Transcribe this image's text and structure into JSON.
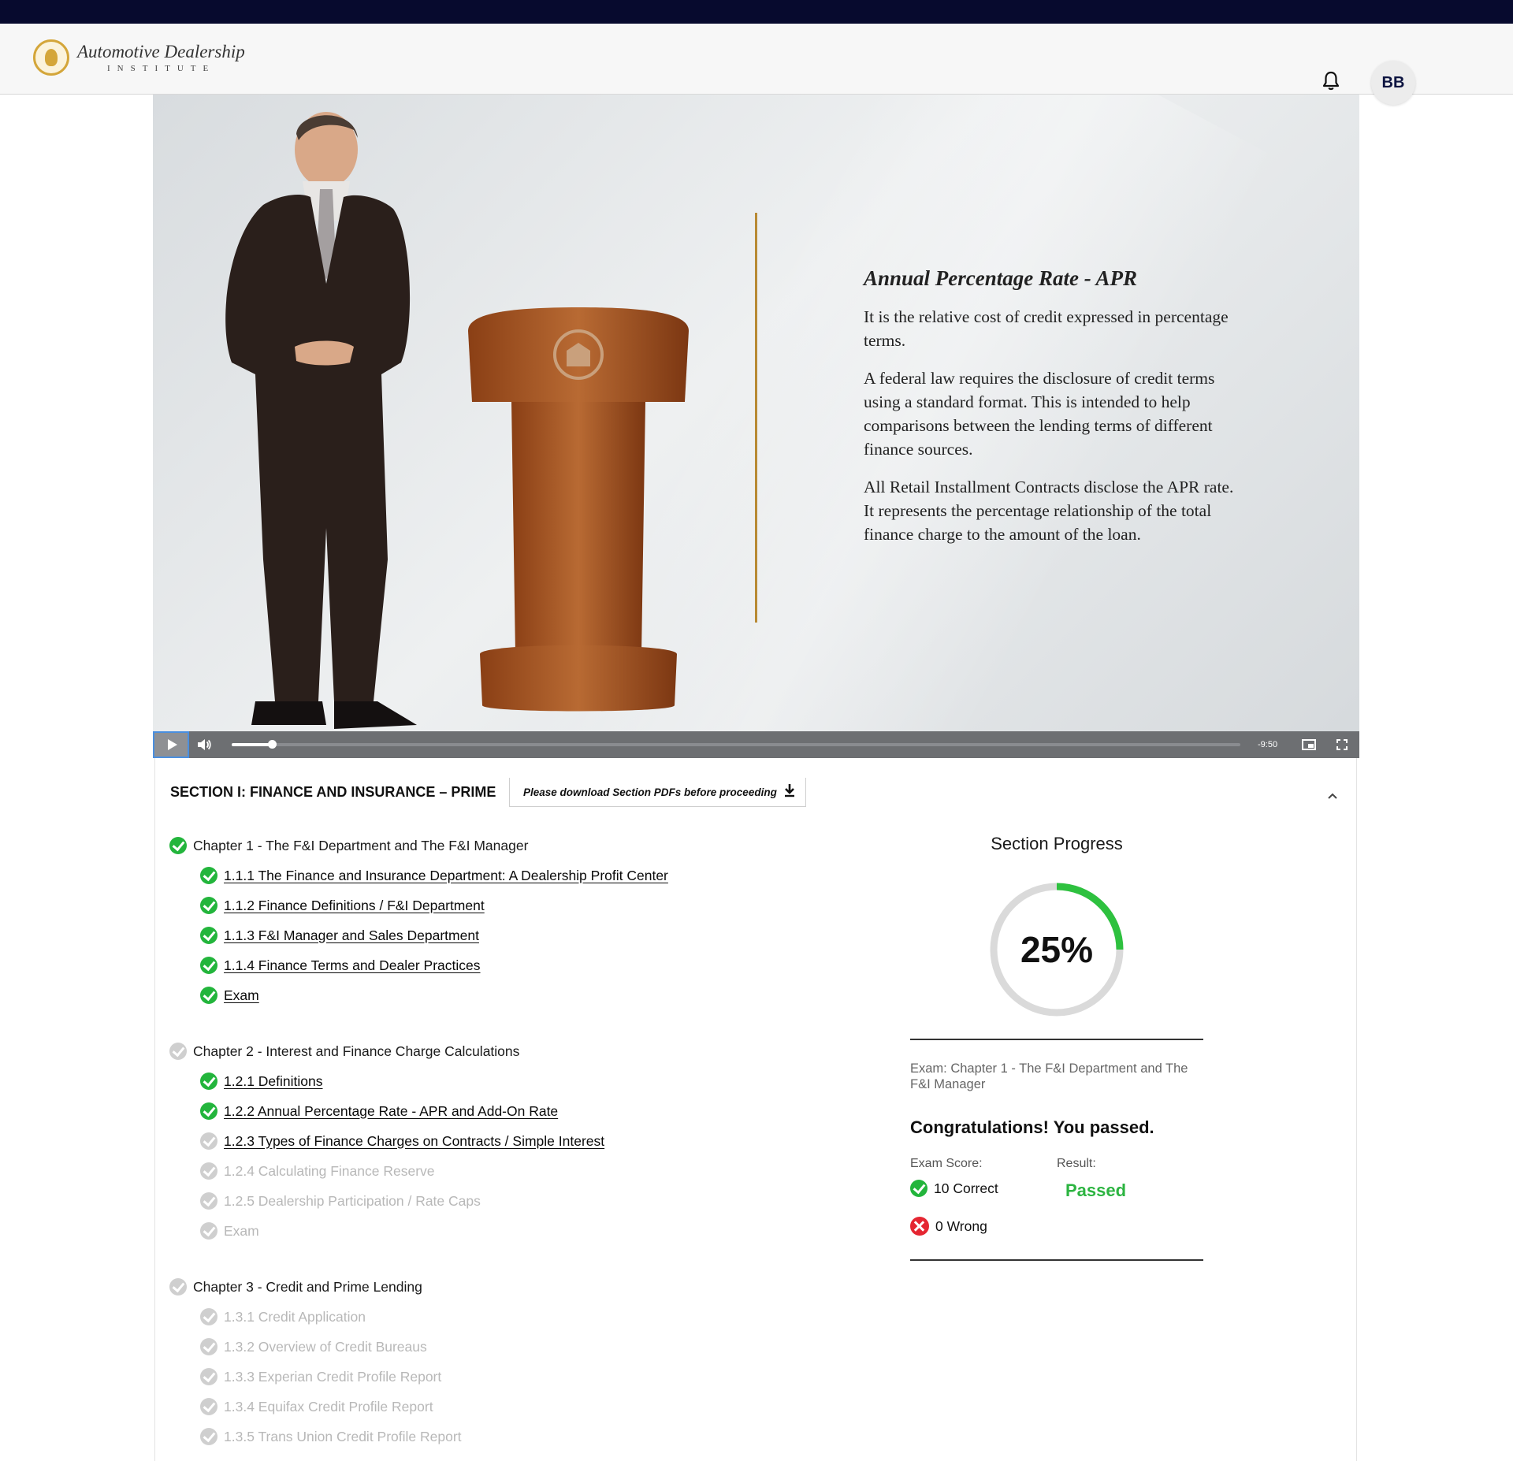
{
  "header": {
    "logo_title": "Automotive Dealership",
    "logo_subtitle": "INSTITUTE",
    "avatar_initials": "BB"
  },
  "video": {
    "slide_title": "Annual Percentage Rate - APR",
    "slide_paragraphs": [
      "It is the relative cost of credit expressed in percentage terms.",
      "A federal law requires the disclosure of credit terms using a standard format. This is intended to help comparisons between the lending terms of different finance sources.",
      "All Retail Installment Contracts disclose the APR rate. It represents the percentage relationship of the total finance charge to the amount of the loan."
    ],
    "time_remaining": "-9:50",
    "progress_fraction": 0.04
  },
  "section": {
    "title": "SECTION I: FINANCE AND INSURANCE – PRIME",
    "pdf_button": "Please download Section PDFs before proceeding"
  },
  "chapters": [
    {
      "title": "Chapter 1 - The F&I Department and The F&I Manager",
      "done": true,
      "lessons": [
        {
          "label": "1.1.1 The Finance and Insurance Department: A Dealership Profit Center",
          "status": "done"
        },
        {
          "label": "1.1.2 Finance Definitions / F&I Department",
          "status": "done"
        },
        {
          "label": "1.1.3 F&I Manager and Sales Department",
          "status": "done"
        },
        {
          "label": "1.1.4 Finance Terms and Dealer Practices",
          "status": "done"
        },
        {
          "label": "Exam",
          "status": "done"
        }
      ]
    },
    {
      "title": "Chapter 2 - Interest and Finance Charge Calculations",
      "done": false,
      "lessons": [
        {
          "label": "1.2.1 Definitions",
          "status": "done"
        },
        {
          "label": "1.2.2 Annual Percentage Rate - APR and Add-On Rate",
          "status": "done"
        },
        {
          "label": "1.2.3 Types of Finance Charges on Contracts / Simple Interest",
          "status": "current"
        },
        {
          "label": "1.2.4 Calculating Finance Reserve",
          "status": "locked"
        },
        {
          "label": "1.2.5 Dealership Participation / Rate Caps",
          "status": "locked"
        },
        {
          "label": "Exam",
          "status": "locked"
        }
      ]
    },
    {
      "title": "Chapter 3 - Credit and Prime Lending",
      "done": false,
      "lessons": [
        {
          "label": "1.3.1 Credit Application",
          "status": "locked"
        },
        {
          "label": "1.3.2 Overview of Credit Bureaus",
          "status": "locked"
        },
        {
          "label": "1.3.3 Experian Credit Profile Report",
          "status": "locked"
        },
        {
          "label": "1.3.4 Equifax Credit Profile Report",
          "status": "locked"
        },
        {
          "label": "1.3.5 Trans Union Credit Profile Report",
          "status": "locked"
        }
      ]
    }
  ],
  "progress": {
    "title": "Section Progress",
    "percent_label": "25%",
    "percent_value": 25,
    "exam_name": "Exam: Chapter 1 - The F&I Department and The F&I Manager",
    "congrats": "Congratulations! You passed.",
    "score_label": "Exam Score:",
    "result_label": "Result:",
    "correct": "10 Correct",
    "wrong": "0 Wrong",
    "result": "Passed"
  },
  "colors": {
    "navy": "#070a2e",
    "green": "#23b53c",
    "red": "#e52632",
    "gold": "#b88a34"
  }
}
